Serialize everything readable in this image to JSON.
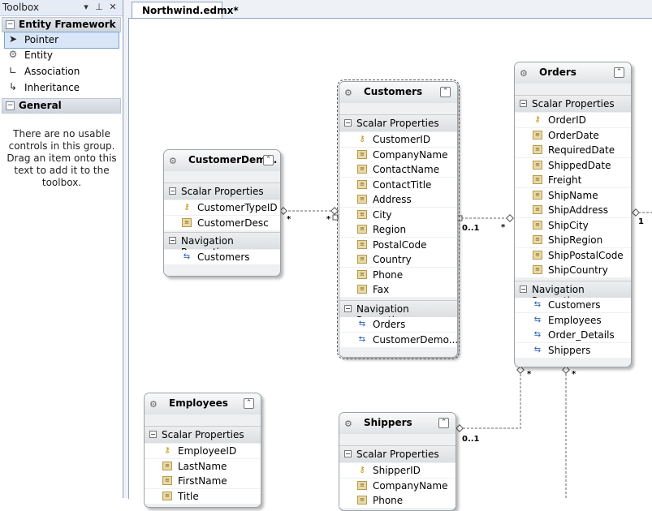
{
  "toolbox": {
    "title": "Toolbox",
    "groups": [
      {
        "label": "Entity Framework",
        "expand": "−"
      },
      {
        "label": "General",
        "expand": "−"
      }
    ],
    "items": [
      {
        "label": "Pointer",
        "icon": "pointer-icon"
      },
      {
        "label": "Entity",
        "icon": "entity-icon"
      },
      {
        "label": "Association",
        "icon": "association-icon"
      },
      {
        "label": "Inheritance",
        "icon": "inheritance-icon"
      }
    ],
    "empty_message": "There are no usable controls in this group. Drag an item onto this text to add it to the toolbox."
  },
  "tab": {
    "label": "Northwind.edmx*"
  },
  "section_labels": {
    "scalar": "Scalar Properties",
    "navigation": "Navigation Properties"
  },
  "entities": {
    "customer_demo": {
      "name": "CustomerDem...",
      "scalar": [
        "CustomerTypeID",
        "CustomerDesc"
      ],
      "navigation": [
        "Customers"
      ]
    },
    "customers": {
      "name": "Customers",
      "scalar": [
        "CustomerID",
        "CompanyName",
        "ContactName",
        "ContactTitle",
        "Address",
        "City",
        "Region",
        "PostalCode",
        "Country",
        "Phone",
        "Fax"
      ],
      "navigation": [
        "Orders",
        "CustomerDemo..."
      ]
    },
    "orders": {
      "name": "Orders",
      "scalar": [
        "OrderID",
        "OrderDate",
        "RequiredDate",
        "ShippedDate",
        "Freight",
        "ShipName",
        "ShipAddress",
        "ShipCity",
        "ShipRegion",
        "ShipPostalCode",
        "ShipCountry"
      ],
      "navigation": [
        "Customers",
        "Employees",
        "Order_Details",
        "Shippers"
      ]
    },
    "employees": {
      "name": "Employees",
      "scalar": [
        "EmployeeID",
        "LastName",
        "FirstName",
        "Title"
      ]
    },
    "shippers": {
      "name": "Shippers",
      "scalar": [
        "ShipperID",
        "CompanyName",
        "Phone"
      ]
    }
  },
  "multiplicities": {
    "demo_left": "*",
    "demo_right": "*",
    "cust_orders_one": "0..1",
    "cust_orders_many": "*",
    "orders_right": "1",
    "orders_bottom_left": "*",
    "orders_bottom_right": "*",
    "shippers_one": "0..1"
  }
}
